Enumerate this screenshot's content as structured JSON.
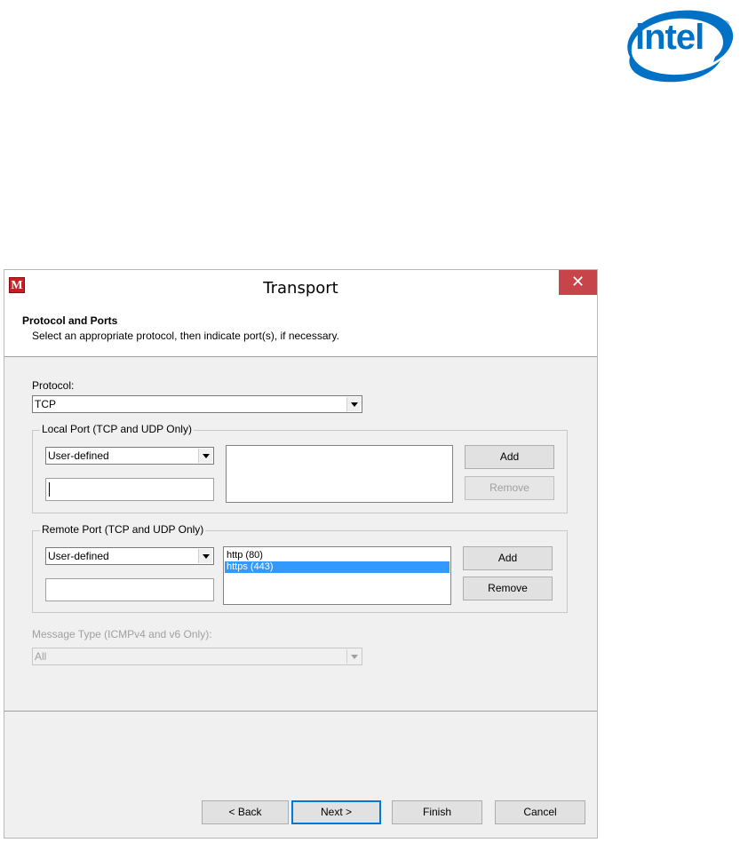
{
  "logo": {
    "text": "intel",
    "reg": "®"
  },
  "window": {
    "title": "Transport",
    "icon_letter": "M",
    "close_glyph": "✕"
  },
  "header": {
    "title": "Protocol and Ports",
    "subtitle": "Select an appropriate protocol, then indicate port(s), if necessary."
  },
  "protocol": {
    "label": "Protocol:",
    "selected": "TCP"
  },
  "local_port": {
    "group_label": "Local Port (TCP and UDP Only)",
    "type_selected": "User-defined",
    "input_value": "",
    "items": [],
    "add_label": "Add",
    "remove_label": "Remove"
  },
  "remote_port": {
    "group_label": "Remote Port (TCP and UDP Only)",
    "type_selected": "User-defined",
    "input_value": "",
    "items": [
      {
        "label": "http (80)",
        "selected": false
      },
      {
        "label": "https (443)",
        "selected": true
      }
    ],
    "add_label": "Add",
    "remove_label": "Remove"
  },
  "message_type": {
    "label": "Message Type (ICMPv4 and v6 Only):",
    "selected": "All"
  },
  "footer": {
    "back_label": "< Back",
    "next_label": "Next >",
    "finish_label": "Finish",
    "cancel_label": "Cancel"
  },
  "colors": {
    "intel_blue": "#0071c5",
    "close_red": "#c7444a",
    "selection": "#3399ff"
  }
}
